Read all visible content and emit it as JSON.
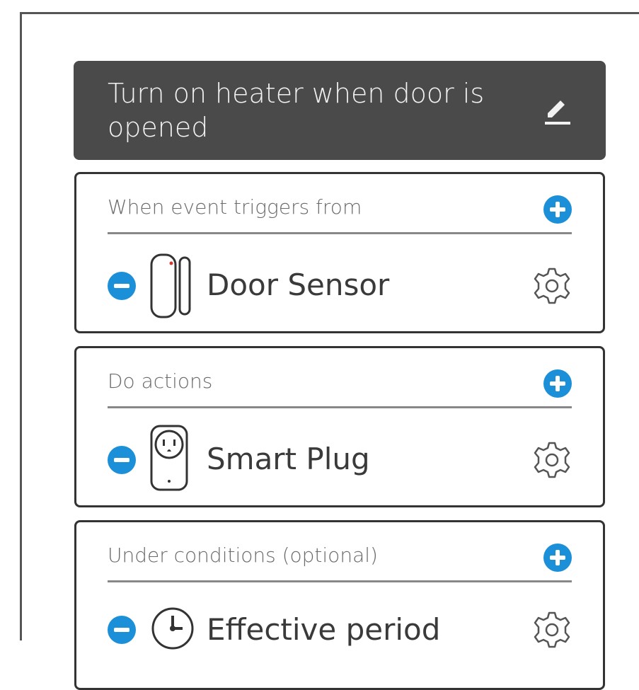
{
  "rule": {
    "title": "Turn on heater when door is opened",
    "edit_icon": "pencil-icon"
  },
  "sections": [
    {
      "id": "trigger",
      "title": "When event triggers from",
      "add_icon": "plus-circle-icon",
      "item": {
        "name": "Door Sensor",
        "icon": "door-sensor-icon",
        "remove_icon": "minus-circle-icon",
        "settings_icon": "gear-icon"
      }
    },
    {
      "id": "actions",
      "title": "Do actions",
      "add_icon": "plus-circle-icon",
      "item": {
        "name": "Smart Plug",
        "icon": "smart-plug-icon",
        "remove_icon": "minus-circle-icon",
        "settings_icon": "gear-icon"
      }
    },
    {
      "id": "conditions",
      "title": "Under conditions (optional)",
      "add_icon": "plus-circle-icon",
      "item": {
        "name": "Effective period",
        "icon": "clock-icon",
        "remove_icon": "minus-circle-icon",
        "settings_icon": "gear-icon"
      }
    }
  ],
  "colors": {
    "accent": "#1b8fd8",
    "title_bar": "#4a4a4a",
    "border": "#333333"
  }
}
